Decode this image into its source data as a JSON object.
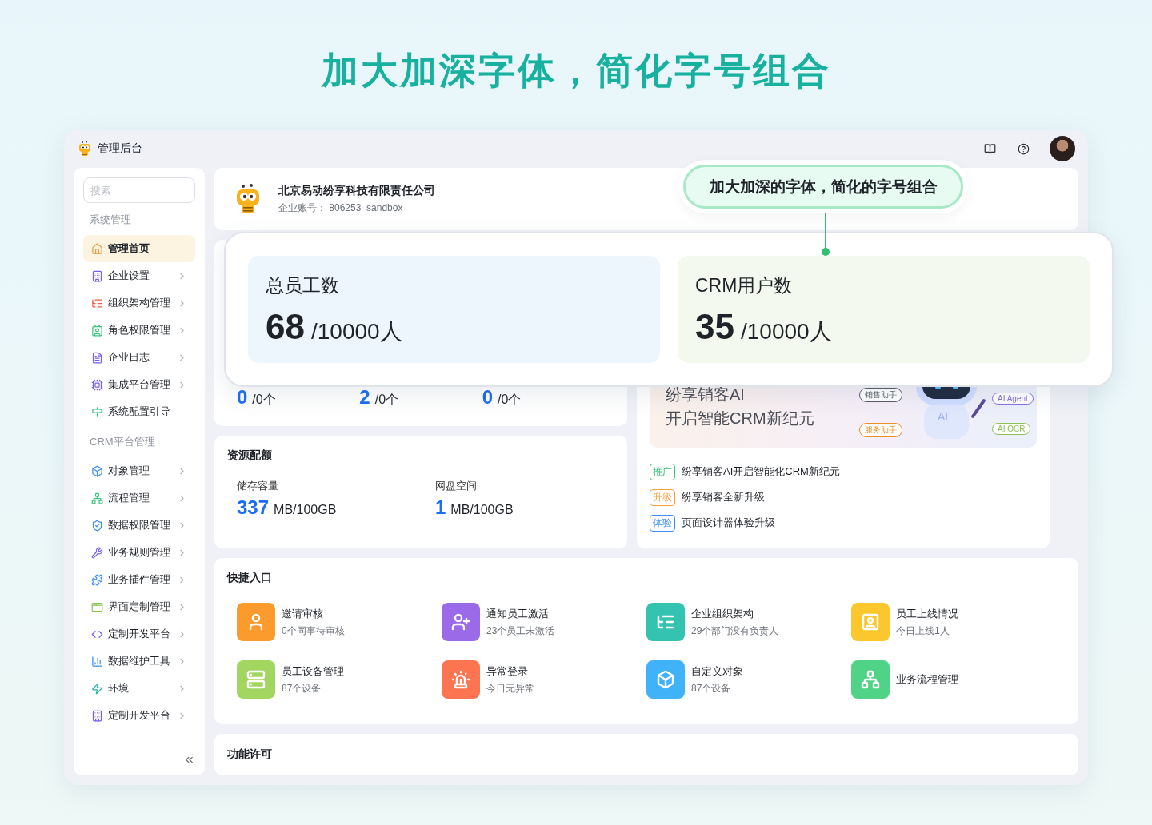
{
  "headline": "加大加深字体，简化字号组合",
  "app": {
    "title": "管理后台"
  },
  "sidebar": {
    "search": {
      "placeholder": "搜索"
    },
    "sections": [
      {
        "title": "系统管理",
        "items": [
          {
            "label": "管理首页",
            "selected": true,
            "has_submenu": false
          },
          {
            "label": "企业设置",
            "selected": false,
            "has_submenu": true
          },
          {
            "label": "组织架构管理",
            "selected": false,
            "has_submenu": true
          },
          {
            "label": "角色权限管理",
            "selected": false,
            "has_submenu": true
          },
          {
            "label": "企业日志",
            "selected": false,
            "has_submenu": true
          },
          {
            "label": "集成平台管理",
            "selected": false,
            "has_submenu": true
          },
          {
            "label": "系统配置引导",
            "selected": false,
            "has_submenu": false
          }
        ]
      },
      {
        "title": "CRM平台管理",
        "items": [
          {
            "label": "对象管理",
            "selected": false,
            "has_submenu": true
          },
          {
            "label": "流程管理",
            "selected": false,
            "has_submenu": true
          },
          {
            "label": "数据权限管理",
            "selected": false,
            "has_submenu": true
          },
          {
            "label": "业务规则管理",
            "selected": false,
            "has_submenu": true
          },
          {
            "label": "业务插件管理",
            "selected": false,
            "has_submenu": true
          },
          {
            "label": "界面定制管理",
            "selected": false,
            "has_submenu": true
          },
          {
            "label": "定制开发平台",
            "selected": false,
            "has_submenu": true
          },
          {
            "label": "数据维护工具",
            "selected": false,
            "has_submenu": true
          },
          {
            "label": "环境",
            "selected": false,
            "has_submenu": true
          },
          {
            "label": "定制开发平台",
            "selected": false,
            "has_submenu": true
          }
        ]
      }
    ]
  },
  "company": {
    "name": "北京易动纷享科技有限责任公司",
    "account": "企业账号：  806253_sandbox"
  },
  "callout": {
    "text": "加大加深的字体，简化的字号组合"
  },
  "highlight_cards": [
    {
      "label": "总员工数",
      "value": "68",
      "total": "/10000人",
      "color": "#edf6fd"
    },
    {
      "label": "CRM用户数",
      "value": "35",
      "total": "/10000人",
      "color": "#f3f9ee"
    }
  ],
  "stats": [
    {
      "value": "0",
      "total": "/0个"
    },
    {
      "value": "2",
      "total": "/0个"
    },
    {
      "value": "0",
      "total": "/0个"
    }
  ],
  "quota": {
    "title": "资源配额",
    "items": [
      {
        "label": "储存容量",
        "value": "337",
        "unit": "MB/100GB"
      },
      {
        "label": "网盘空间",
        "value": "1",
        "unit": "MB/100GB"
      }
    ]
  },
  "banner": {
    "title_lines": [
      "纷享销客AI",
      "开启智能CRM新纪元"
    ],
    "robot_label": "AI",
    "chips": [
      {
        "text": "销售助手",
        "color": "#555b66"
      },
      {
        "text": "AI Agent",
        "color": "#8a6ee0"
      },
      {
        "text": "服务助手",
        "color": "#f08a24"
      },
      {
        "text": "AI OCR",
        "color": "#8cc152"
      }
    ]
  },
  "news": [
    {
      "tag": "推广",
      "color": "#3cc47c",
      "text": "纷享销客AI开启智能化CRM新纪元"
    },
    {
      "tag": "升级",
      "color": "#f7a13c",
      "text": "纷享销客全新升级"
    },
    {
      "tag": "体验",
      "color": "#3d8ff5",
      "text": "页面设计器体验升级"
    }
  ],
  "quick_entry": {
    "title": "快捷入口",
    "items": [
      {
        "title": "邀请审核",
        "subtitle": "0个同事待审核",
        "color": "#fb9a2d"
      },
      {
        "title": "通知员工激活",
        "subtitle": "23个员工未激活",
        "color": "#9b6ae8"
      },
      {
        "title": "企业组织架构",
        "subtitle": "29个部门没有负责人",
        "color": "#34c2b1"
      },
      {
        "title": "员工上线情况",
        "subtitle": "今日上线1人",
        "color": "#fcc62d"
      },
      {
        "title": "员工设备管理",
        "subtitle": "87个设备",
        "color": "#a3d661"
      },
      {
        "title": "异常登录",
        "subtitle": "今日无异常",
        "color": "#fd7550"
      },
      {
        "title": "自定义对象",
        "subtitle": "87个设备",
        "color": "#3fb2f8"
      },
      {
        "title": "业务流程管理",
        "color": "#50d386"
      }
    ]
  },
  "license": {
    "title": "功能许可"
  }
}
